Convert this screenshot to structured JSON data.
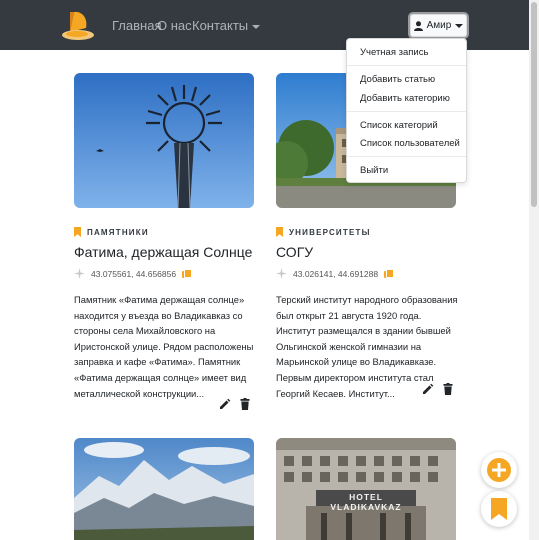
{
  "nav": {
    "home": "Главная",
    "about": "О нас",
    "contacts": "Контакты",
    "user": "Амир"
  },
  "dropdown": {
    "account": "Учетная запись",
    "add_article": "Добавить статью",
    "add_category": "Добавить категорию",
    "category_list": "Список категорий",
    "user_list": "Список пользователей",
    "logout": "Выйти"
  },
  "cards": [
    {
      "category": "ПАМЯТНИКИ",
      "title": "Фатима, держащая Солнце",
      "coords": "43.075561, 44.656856",
      "desc": "Памятник «Фатима держащая солнце» находится у въезда во Владикавказ со стороны села Михайловского на Иристонской улице. Рядом расположены заправка и кафе «Фатима». Памятник «Фатима держащая солнце» имеет вид металлической конструкции..."
    },
    {
      "category": "УНИВЕРСИТЕТЫ",
      "title": "СОГУ",
      "coords": "43.026141, 44.691288",
      "desc": "Терский институт народного образования был открыт 21 августа 1920 года. Институт размещался в здании бывшей Ольгинской женской гимназии на Марьинской улице во Владикавказе. Первым директором института стал Георгий Кесаев. Институт..."
    }
  ],
  "hotel_sign": "HOTEL VLADIKAVKAZ",
  "colors": {
    "accent": "#f5a623",
    "navbar": "#343a40"
  }
}
